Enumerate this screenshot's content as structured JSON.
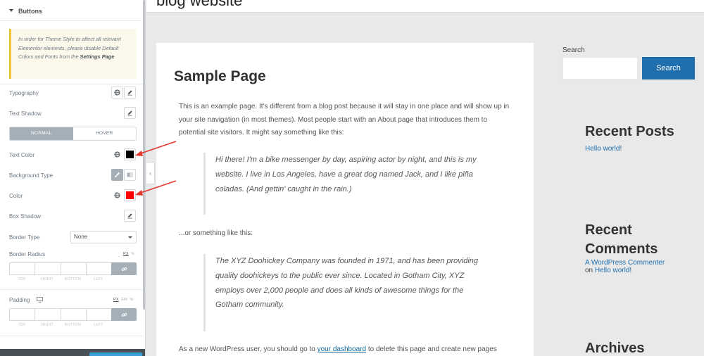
{
  "panel": {
    "section_title": "Buttons",
    "notice": {
      "text": "In order for Theme Style to affect all relevant Elementor elements, please disable Default Colors and Fonts from the",
      "link": "Settings Page"
    },
    "typography_label": "Typography",
    "text_shadow_label": "Text Shadow",
    "tabs": {
      "normal": "NORMAL",
      "hover": "HOVER"
    },
    "text_color_label": "Text Color",
    "text_color_value": "#000000",
    "background_type_label": "Background Type",
    "color_label": "Color",
    "color_value": "#ff0000",
    "box_shadow_label": "Box Shadow",
    "border_type_label": "Border Type",
    "border_type_value": "None",
    "border_radius_label": "Border Radius",
    "radius_units": {
      "px": "PX",
      "pct": "%"
    },
    "dimension_labels": {
      "top": "TOP",
      "right": "RIGHT",
      "bottom": "BOTTOM",
      "left": "LEFT"
    },
    "padding_label": "Padding",
    "padding_units": {
      "px": "PX",
      "em": "EM",
      "pct": "%"
    }
  },
  "site": {
    "title": "blog website",
    "page_title": "Sample Page",
    "intro": "This is an example page. It's different from a blog post because it will stay in one place and will show up in your site navigation (in most themes). Most people start with an About page that introduces them to potential site visitors. It might say something like this:",
    "quote1": "Hi there! I'm a bike messenger by day, aspiring actor by night, and this is my website. I live in Los Angeles, have a great dog named Jack, and I like piña coladas. (And gettin' caught in the rain.)",
    "middle": "...or something like this:",
    "quote2": "The XYZ Doohickey Company was founded in 1971, and has been providing quality doohickeys to the public ever since. Located in Gotham City, XYZ employs over 2,000 people and does all kinds of awesome things for the Gotham community.",
    "outro_before": "As a new WordPress user, you should go to ",
    "outro_link": "your dashboard",
    "outro_after": " to delete this page and create new pages"
  },
  "sidebar": {
    "search_label": "Search",
    "search_button": "Search",
    "recent_posts_title": "Recent Posts",
    "recent_post_link": "Hello world!",
    "recent_comments_title": "Recent Comments",
    "commenter": "A WordPress Commenter",
    "comment_on": "on",
    "comment_post": "Hello world!",
    "archives_title": "Archives"
  },
  "colors": {
    "accent": "#1f6ead",
    "annotation_arrow": "#e0372b"
  }
}
